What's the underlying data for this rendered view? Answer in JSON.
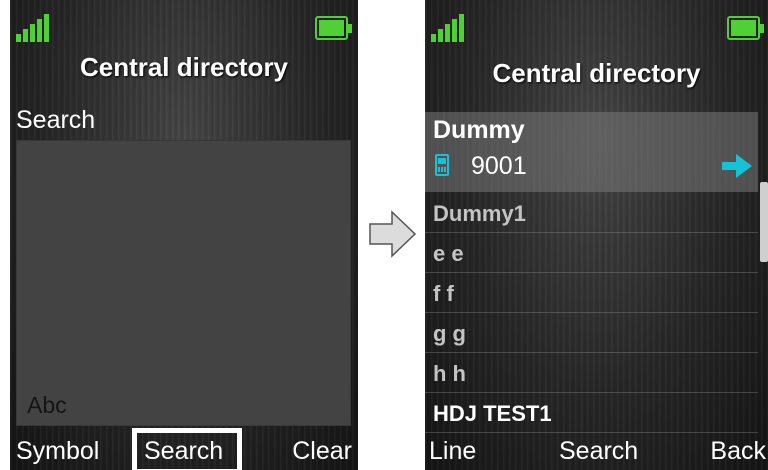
{
  "left_screen": {
    "title": "Central directory",
    "search_label": "Search",
    "input_mode": "Abc",
    "softkeys": {
      "left": "Symbol",
      "center": "Search",
      "right": "Clear"
    }
  },
  "right_screen": {
    "title": "Central directory",
    "selected_entry": {
      "name": "Dummy",
      "number": "9001"
    },
    "entries": [
      "Dummy1",
      "e e",
      "f f",
      "g g",
      "h h",
      "HDJ TEST1"
    ],
    "softkeys": {
      "left": "Line",
      "center": "Search",
      "right": "Back"
    }
  },
  "colors": {
    "signal": "#4fd136",
    "battery": "#4fd136",
    "phone_icon": "#16c3d6",
    "go_arrow": "#16c3d6"
  },
  "icons": {
    "signal": "signal-strength-icon",
    "battery": "battery-icon",
    "transition": "right-arrow-icon",
    "number_type": "mobile-phone-icon",
    "action": "right-arrow-icon"
  }
}
